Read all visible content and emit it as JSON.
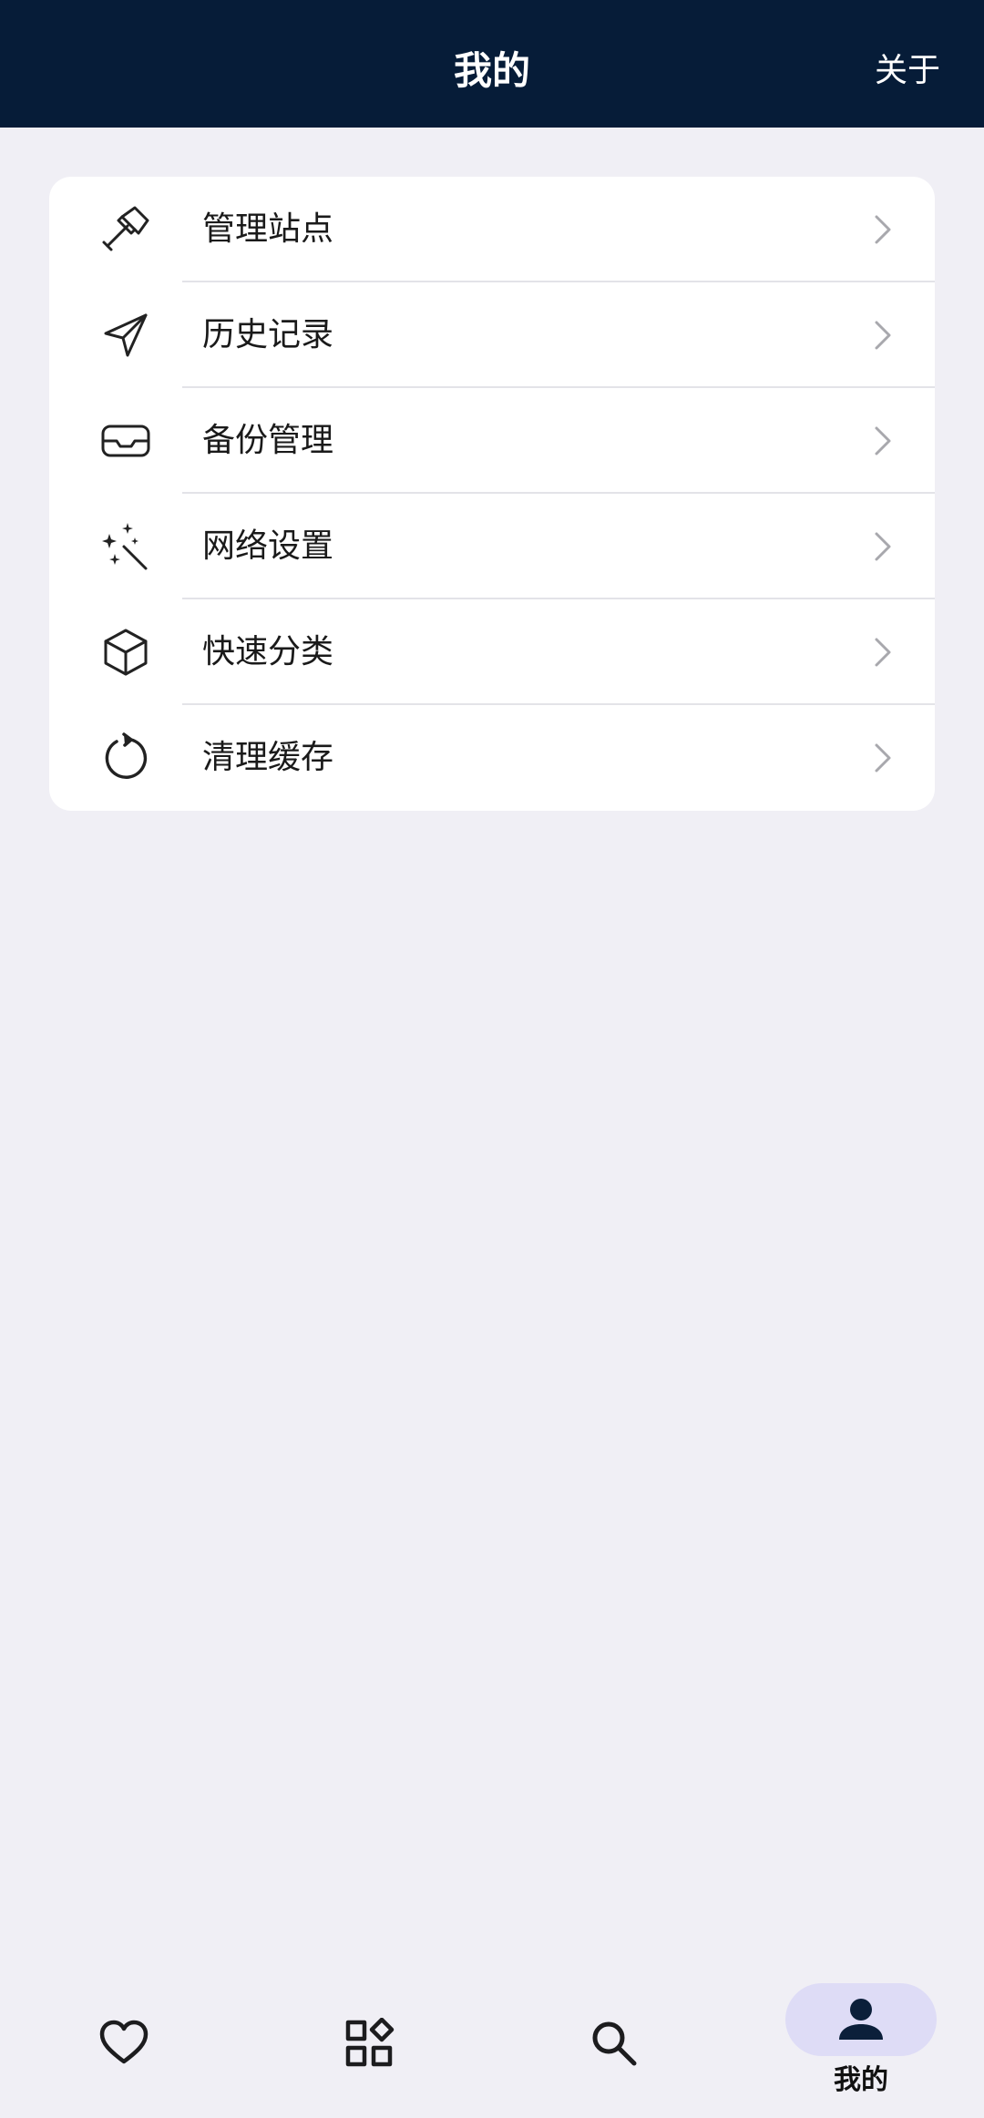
{
  "header": {
    "title": "我的",
    "about_label": "关于",
    "background_color": "#061c38"
  },
  "menu": {
    "items": [
      {
        "label": "管理站点",
        "icon": "hammer-icon"
      },
      {
        "label": "历史记录",
        "icon": "send-icon"
      },
      {
        "label": "备份管理",
        "icon": "inbox-icon"
      },
      {
        "label": "网络设置",
        "icon": "magic-wand-icon"
      },
      {
        "label": "快速分类",
        "icon": "cube-icon"
      },
      {
        "label": "清理缓存",
        "icon": "refresh-icon"
      }
    ]
  },
  "tabbar": {
    "items": [
      {
        "icon": "heart-icon"
      },
      {
        "icon": "category-icon"
      },
      {
        "icon": "search-icon"
      },
      {
        "icon": "person-icon",
        "label": "我的",
        "active": true
      }
    ],
    "active_pill_color": "#dedcf6"
  }
}
